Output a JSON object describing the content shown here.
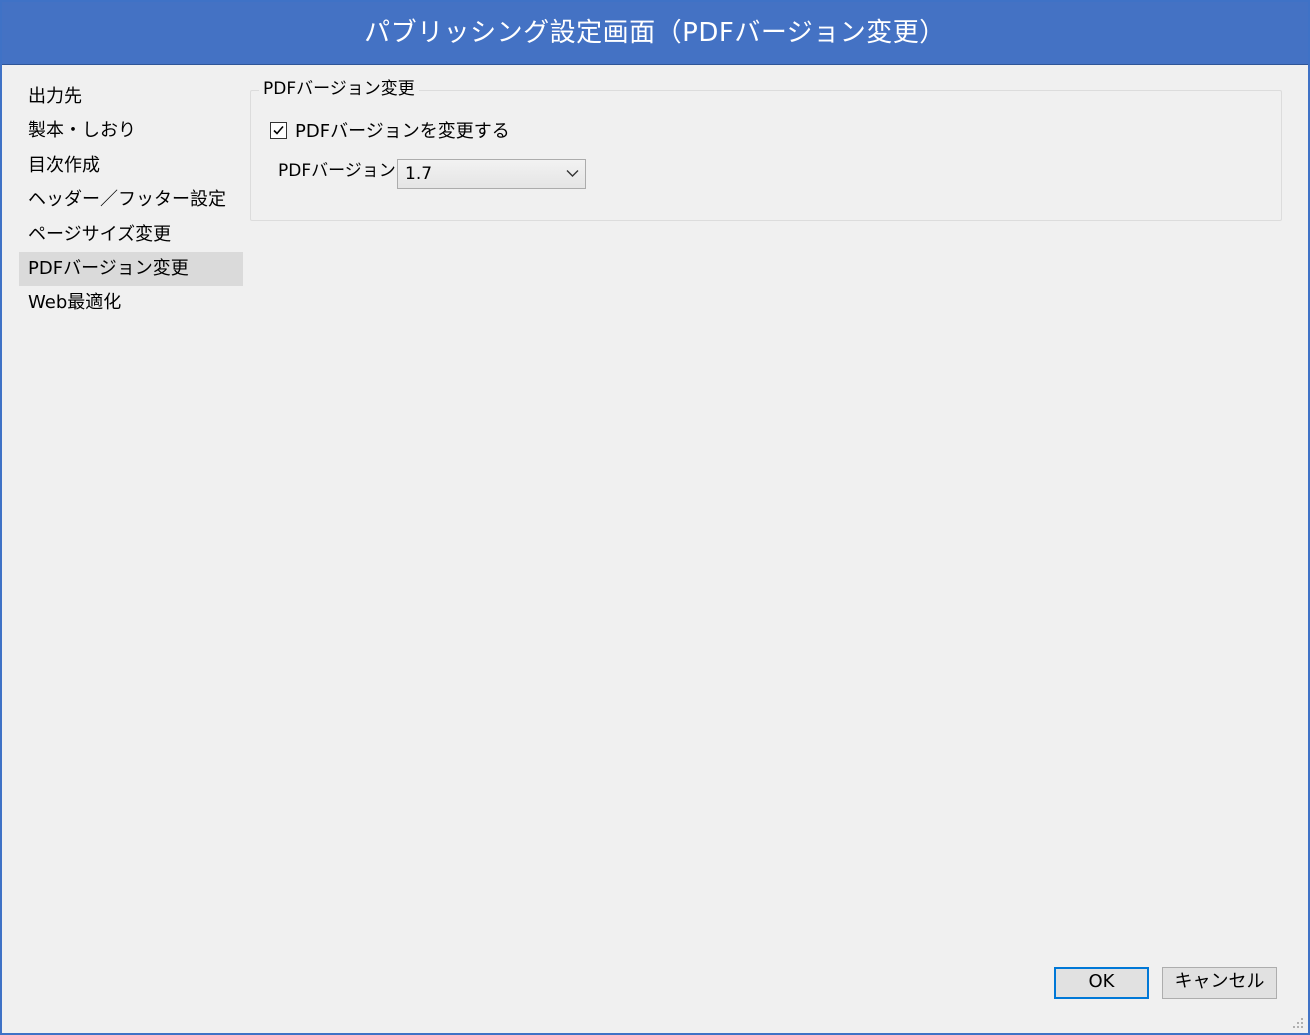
{
  "window": {
    "title": "パブリッシング設定画面（PDFバージョン変更）"
  },
  "sidebar": {
    "items": [
      {
        "label": "出力先"
      },
      {
        "label": "製本・しおり"
      },
      {
        "label": "目次作成"
      },
      {
        "label": "ヘッダー／フッター設定"
      },
      {
        "label": "ページサイズ変更"
      },
      {
        "label": "PDFバージョン変更",
        "selected": true
      },
      {
        "label": "Web最適化"
      }
    ]
  },
  "group": {
    "legend": "PDFバージョン変更",
    "checkbox_label": "PDFバージョンを変更する",
    "checkbox_checked": true,
    "version_label": "PDFバージョン",
    "version_value": "1.7"
  },
  "buttons": {
    "ok": "OK",
    "cancel": "キャンセル"
  },
  "colors": {
    "titlebar": "#4472c4",
    "window_bg": "#f0f0f0",
    "selected_item": "#dadada",
    "focus_border": "#0078d7"
  }
}
